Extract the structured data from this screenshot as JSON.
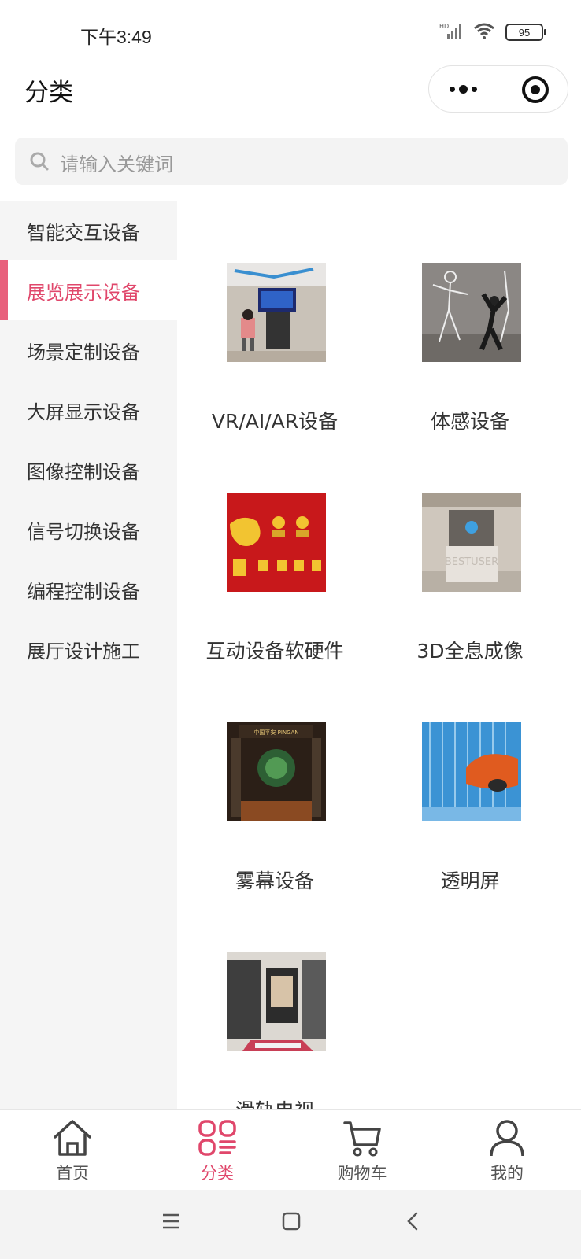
{
  "status": {
    "time": "下午3:49",
    "battery": "95",
    "network": "HD"
  },
  "header": {
    "title": "分类"
  },
  "search": {
    "placeholder": "请输入关键词"
  },
  "sidebar": {
    "items": [
      {
        "label": "智能交互设备"
      },
      {
        "label": "展览展示设备",
        "active": true
      },
      {
        "label": "场景定制设备"
      },
      {
        "label": "大屏显示设备"
      },
      {
        "label": "图像控制设备"
      },
      {
        "label": "信号切换设备"
      },
      {
        "label": "编程控制设备"
      },
      {
        "label": "展厅设计施工"
      }
    ]
  },
  "products": [
    {
      "label": "VR/AI/AR设备"
    },
    {
      "label": "体感设备"
    },
    {
      "label": "互动设备软硬件"
    },
    {
      "label": "3D全息成像"
    },
    {
      "label": "雾幕设备"
    },
    {
      "label": "透明屏"
    },
    {
      "label": "滑轨电视"
    }
  ],
  "thumb_texts": {
    "hologram": "BESTUSER",
    "fog": "中国平安 PINGAN"
  },
  "tabbar": {
    "items": [
      {
        "label": "首页",
        "icon": "home-icon"
      },
      {
        "label": "分类",
        "icon": "category-icon",
        "active": true
      },
      {
        "label": "购物车",
        "icon": "cart-icon"
      },
      {
        "label": "我的",
        "icon": "user-icon"
      }
    ]
  },
  "colors": {
    "accent": "#e0476b",
    "sidebar_bg": "#f5f5f5"
  }
}
